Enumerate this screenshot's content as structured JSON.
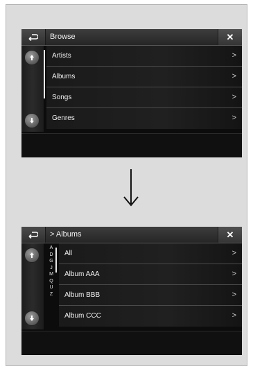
{
  "screen1": {
    "title": "Browse",
    "items": [
      {
        "label": "Artists",
        "chevron": ">"
      },
      {
        "label": "Albums",
        "chevron": ">"
      },
      {
        "label": "Songs",
        "chevron": ">"
      },
      {
        "label": "Genres",
        "chevron": ">"
      }
    ],
    "close_label": "✕"
  },
  "screen2": {
    "title": "> Albums",
    "items": [
      {
        "label": "All",
        "chevron": ">"
      },
      {
        "label": "Album AAA",
        "chevron": ">"
      },
      {
        "label": "Album BBB",
        "chevron": ">"
      },
      {
        "label": "Album CCC",
        "chevron": ">"
      }
    ],
    "alphabet": [
      "A",
      "D",
      "G",
      "J",
      "M",
      "Q",
      "U",
      "Z"
    ],
    "close_label": "✕"
  },
  "icons": {
    "back": "back-arrow-icon",
    "close": "close-icon",
    "scroll_up": "double-chevron-up-icon",
    "scroll_down": "double-chevron-down-icon",
    "transition": "down-arrow-icon"
  }
}
